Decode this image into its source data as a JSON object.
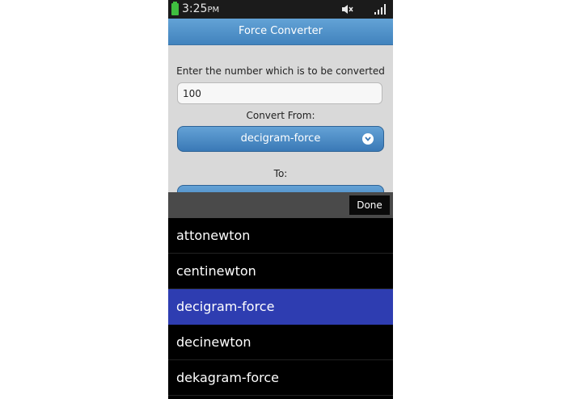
{
  "status_bar": {
    "time": "3:25",
    "ampm": "PM",
    "icons": [
      "battery-icon",
      "mute-icon",
      "signal-icon"
    ]
  },
  "header": {
    "title": "Force Converter"
  },
  "form": {
    "prompt": "Enter the number which is to be converted",
    "input_value": "100",
    "from_label": "Convert From:",
    "from_selected": "decigram-force",
    "to_label": "To:"
  },
  "picker": {
    "done_label": "Done",
    "items": [
      {
        "label": "attonewton",
        "selected": false
      },
      {
        "label": "centinewton",
        "selected": false
      },
      {
        "label": "decigram-force",
        "selected": true
      },
      {
        "label": "decinewton",
        "selected": false
      },
      {
        "label": "dekagram-force",
        "selected": false
      }
    ]
  },
  "colors": {
    "accent": "#4183bd",
    "picker_selected": "#2e3db1",
    "battery": "#3fbf3f"
  }
}
